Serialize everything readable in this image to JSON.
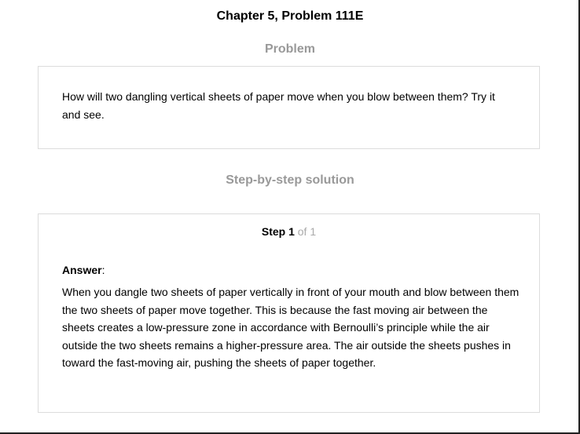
{
  "header": {
    "chapter_title": "Chapter 5, Problem 111E"
  },
  "problem": {
    "heading": "Problem",
    "text": "How will two dangling vertical sheets of paper move when you blow between them? Try it and see."
  },
  "solution": {
    "heading": "Step-by-step solution",
    "step_label": "Step 1",
    "step_of": " of 1",
    "answer_label": "Answer",
    "answer_colon": ":",
    "answer_text": "When you dangle two sheets of paper vertically in front of your mouth and blow between them the two sheets of paper move together. This is because the fast moving air between the sheets creates a low-pressure zone in accordance with Bernoulli’s principle while the air outside the two sheets remains a higher-pressure area. The air outside the sheets pushes in toward the fast-moving air, pushing the sheets of paper together."
  },
  "colors": {
    "heading_gray": "#999999",
    "border": "#dcdcdc",
    "step_of_gray": "#aaaaaa"
  }
}
